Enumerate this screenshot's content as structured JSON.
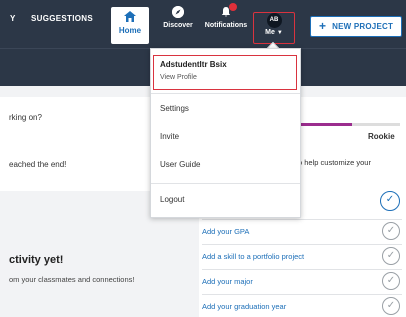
{
  "navbar": {
    "home_label": "Home",
    "discover_label": "Discover",
    "notifications_label": "Notifications",
    "me_label": "Me",
    "avatar_initials": "AB",
    "new_project_label": "NEW PROJECT"
  },
  "subtabs": {
    "partial_label": "Y",
    "suggestions_label": "SUGGESTIONS"
  },
  "left": {
    "working_text": "rking on?",
    "reached_text": "eached the end!",
    "activity_title": "ctivity yet!",
    "activity_sub": "om your classmates and connections!"
  },
  "right": {
    "progress_fraction": 0.52,
    "level_label": "Rookie",
    "help_text": "o help customize your",
    "tasks": [
      {
        "label": "Add your GPA"
      },
      {
        "label": "Add a skill to a portfolio project"
      },
      {
        "label": "Add your major"
      },
      {
        "label": "Add your graduation year"
      }
    ]
  },
  "dropdown": {
    "user_name": "Adstudentltr Bsix",
    "view_profile": "View Profile",
    "items": [
      "Settings",
      "Invite",
      "User Guide",
      "Logout"
    ]
  },
  "colors": {
    "navbar_bg": "#2c3747",
    "accent": "#1d6fb8",
    "highlight": "#d9333f",
    "progress": "#9b2d8e"
  }
}
